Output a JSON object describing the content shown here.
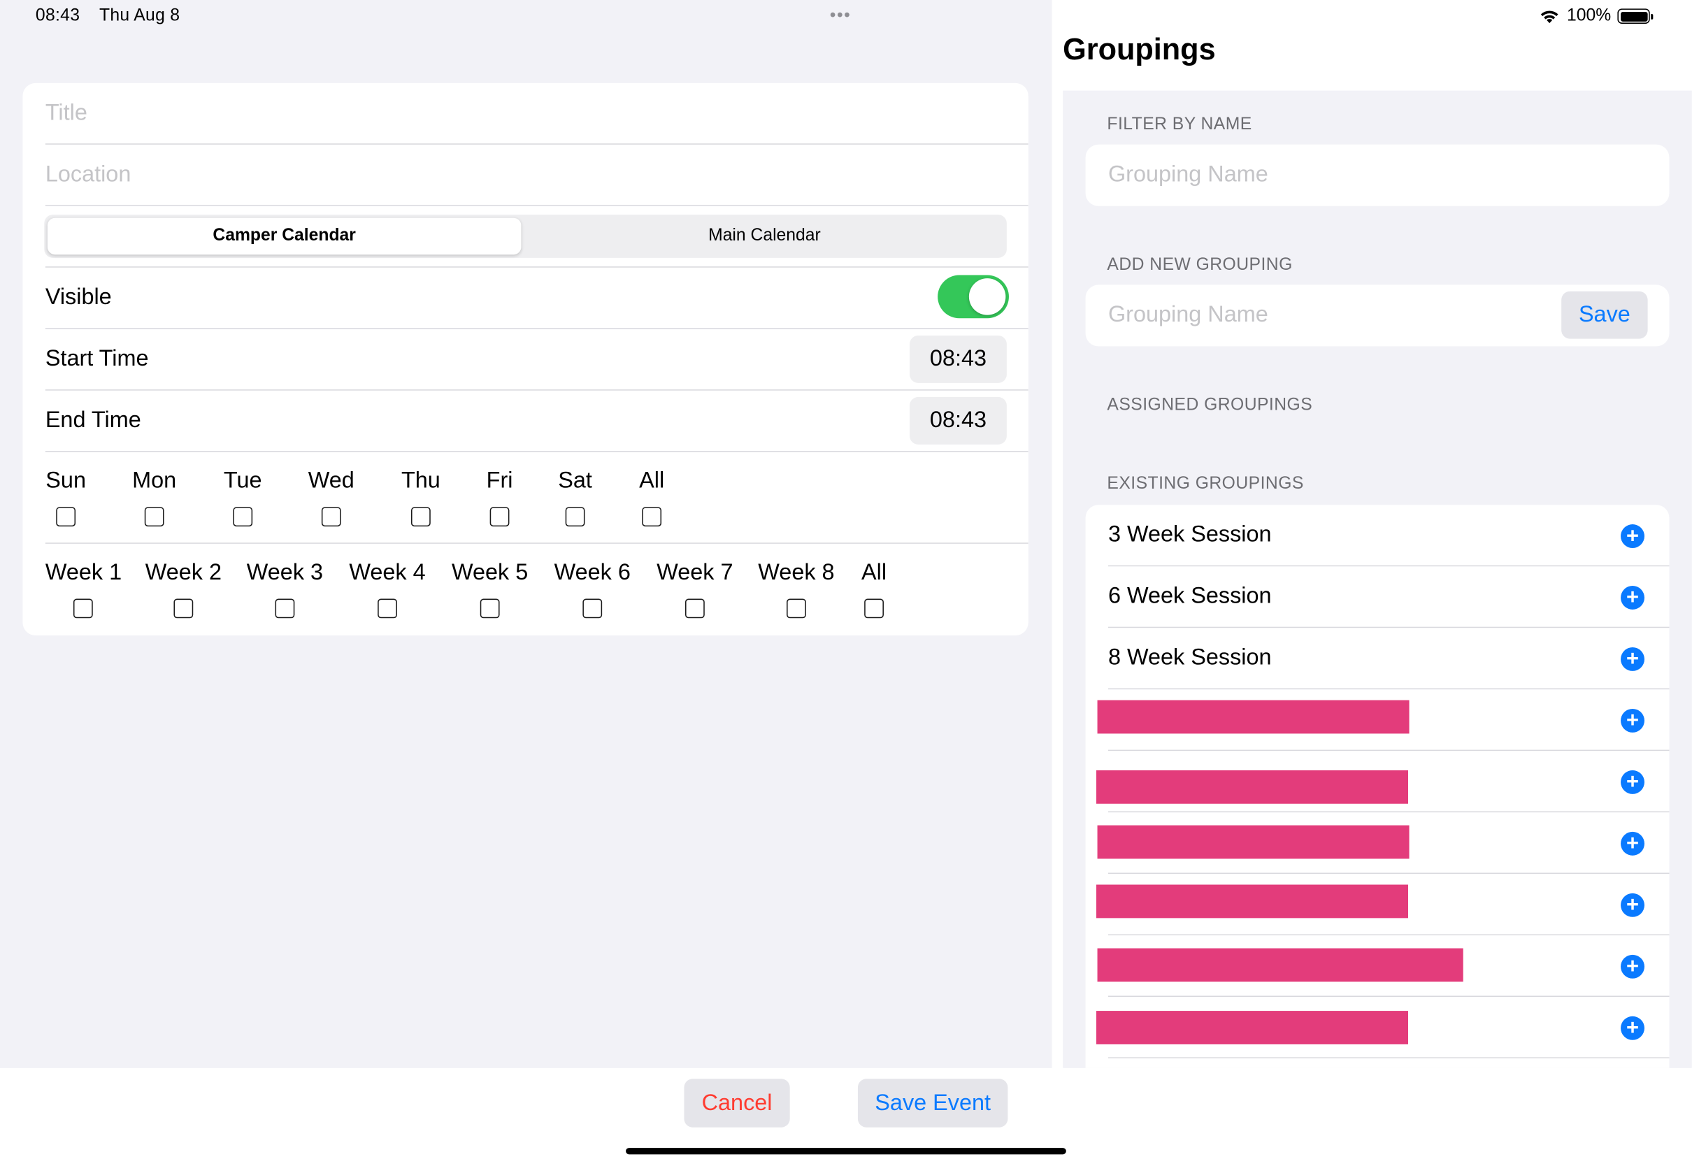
{
  "status_bar": {
    "time": "08:43",
    "date": "Thu Aug 8",
    "multitask_dots": "•••",
    "battery_percent": "100%"
  },
  "event_form": {
    "title_placeholder": "Title",
    "location_placeholder": "Location",
    "calendar_segments": [
      "Camper Calendar",
      "Main Calendar"
    ],
    "selected_calendar": "Camper Calendar",
    "visible_label": "Visible",
    "visible_on": true,
    "start_time_label": "Start Time",
    "start_time_value": "08:43",
    "end_time_label": "End Time",
    "end_time_value": "08:43",
    "days": [
      "Sun",
      "Mon",
      "Tue",
      "Wed",
      "Thu",
      "Fri",
      "Sat",
      "All"
    ],
    "weeks": [
      "Week 1",
      "Week 2",
      "Week 3",
      "Week 4",
      "Week 5",
      "Week 6",
      "Week 7",
      "Week 8",
      "All"
    ]
  },
  "groupings": {
    "title": "Groupings",
    "filter_header": "FILTER BY NAME",
    "filter_placeholder": "Grouping Name",
    "add_header": "ADD NEW GROUPING",
    "add_placeholder": "Grouping Name",
    "save_label": "Save",
    "assigned_header": "ASSIGNED GROUPINGS",
    "existing_header": "EXISTING GROUPINGS",
    "existing": [
      "3 Week Session",
      "6 Week Session",
      "8 Week Session"
    ],
    "redacted_count": 6,
    "add_icon": "plus-circle-icon"
  },
  "actions": {
    "cancel_label": "Cancel",
    "save_event_label": "Save Event"
  },
  "colors": {
    "accent": "#0a7aff",
    "toggle_on": "#34c759",
    "destructive": "#ff3b30",
    "redaction": "#e33c7b"
  }
}
